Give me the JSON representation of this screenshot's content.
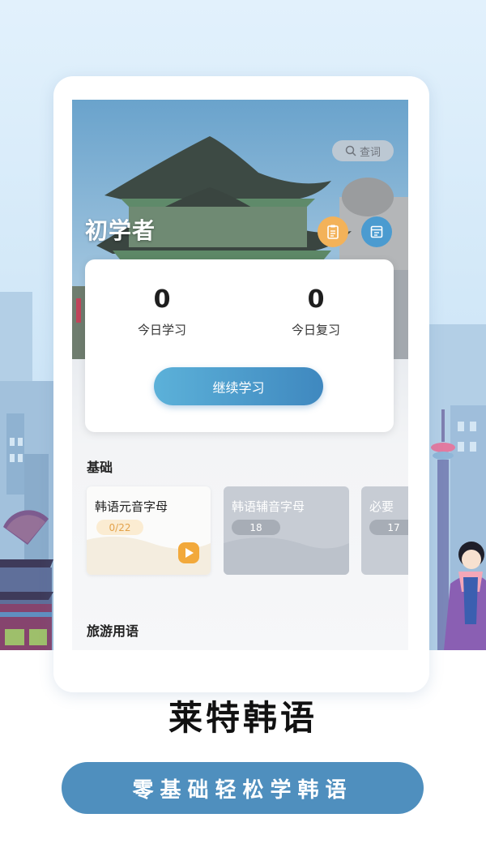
{
  "app": {
    "search_label": "查词",
    "level_title": "初学者",
    "stats": {
      "today_learned_value": "0",
      "today_learned_label": "今日学习",
      "today_review_value": "0",
      "today_review_label": "今日复习"
    },
    "continue_label": "继续学习",
    "sections": [
      {
        "title": "基础",
        "courses": [
          {
            "name": "韩语元音字母",
            "progress": "0/22",
            "locked": false
          },
          {
            "name": "韩语辅音字母",
            "count": "18",
            "locked": true
          },
          {
            "name": "必要",
            "count": "17",
            "locked": true
          }
        ]
      },
      {
        "title": "旅游用语"
      }
    ]
  },
  "promo": {
    "brand_name": "莱特韩语",
    "slogan": "零基础轻松学韩语"
  },
  "colors": {
    "accent_blue": "#4f8fbe",
    "button_gradient": [
      "#5cb1d9",
      "#3f88bf"
    ],
    "notes_button": "#f3b259",
    "plan_button": "#4b9bd0",
    "progress_text": "#e3a24a",
    "play_icon": "#f2a93b"
  }
}
